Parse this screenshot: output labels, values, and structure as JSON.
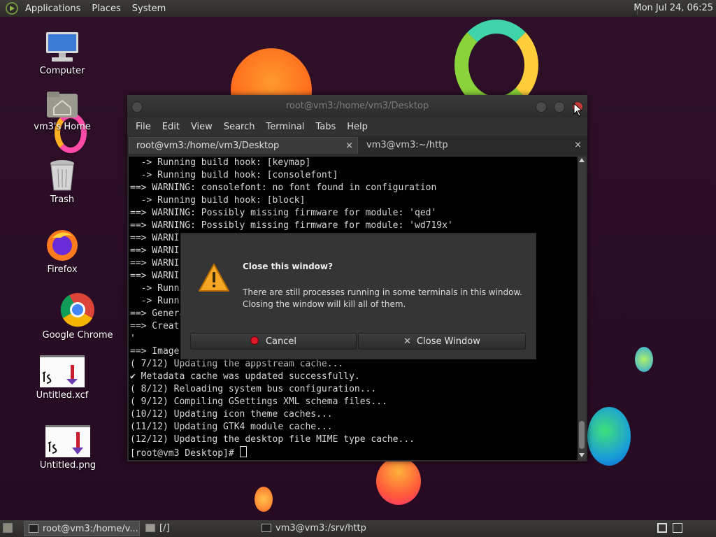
{
  "top_panel": {
    "menus": [
      "Applications",
      "Places",
      "System"
    ],
    "clock": "Mon Jul 24, 06:25"
  },
  "desktop_icons": [
    {
      "label": "Computer",
      "icon": "computer-icon"
    },
    {
      "label": "vm3's Home",
      "icon": "home-folder-icon"
    },
    {
      "label": "Trash",
      "icon": "trash-icon"
    },
    {
      "label": "Firefox",
      "icon": "firefox-icon"
    },
    {
      "label": "Google Chrome",
      "icon": "chrome-icon"
    },
    {
      "label": "Untitled.xcf",
      "icon": "image-file-icon"
    },
    {
      "label": "Untitled.png",
      "icon": "image-file-icon"
    }
  ],
  "terminal": {
    "title": "root@vm3:/home/vm3/Desktop",
    "menu": [
      "File",
      "Edit",
      "View",
      "Search",
      "Terminal",
      "Tabs",
      "Help"
    ],
    "tabs": [
      {
        "label": "root@vm3:/home/vm3/Desktop",
        "close": "×"
      },
      {
        "label": "vm3@vm3:~/http",
        "close": "×"
      }
    ],
    "lines": [
      "  -> Running build hook: [keymap]",
      "  -> Running build hook: [consolefont]",
      "==> WARNING: consolefont: no font found in configuration",
      "  -> Running build hook: [block]",
      "==> WARNING: Possibly missing firmware for module: 'qed'",
      "==> WARNING: Possibly missing firmware for module: 'wd719x'",
      "==> WARNI",
      "==> WARNI",
      "==> WARNI",
      "==> WARNI",
      "  -> Runni",
      "  -> Runni",
      "==> Genera",
      "==> Creat                                                        pack.img",
      "'",
      "==> Image",
      "( 7/12) Updating the appstream cache...",
      "✔ Metadata cache was updated successfully.",
      "( 8/12) Reloading system bus configuration...",
      "( 9/12) Compiling GSettings XML schema files...",
      "(10/12) Updating icon theme caches...",
      "(11/12) Updating GTK4 module cache...",
      "(12/12) Updating the desktop file MIME type cache..."
    ],
    "prompt": "[root@vm3 Desktop]# "
  },
  "dialog": {
    "title": "Close this window?",
    "message_line1": "There are still processes running in some terminals in this window.",
    "message_line2": "Closing the window will kill all of them.",
    "cancel_label": "Cancel",
    "close_label": "Close Window",
    "close_glyph": "✕"
  },
  "taskbar": {
    "items": [
      {
        "label": "root@vm3:/home/v...",
        "icon": "terminal-icon",
        "active": true
      },
      {
        "label": "[/]",
        "icon": "folder-icon",
        "active": false
      },
      {
        "label": "vm3@vm3:/srv/http",
        "icon": "terminal-icon",
        "active": false
      }
    ]
  },
  "colors": {
    "desktop_bg": "#2a0f24",
    "cancel_dot": "#e0192a",
    "warning_fill": "#f5a623"
  }
}
